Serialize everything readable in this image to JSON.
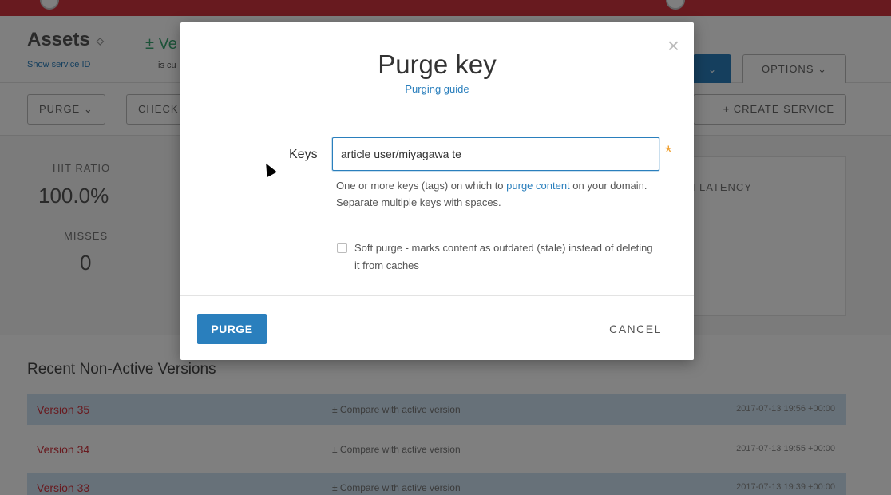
{
  "background": {
    "title": "Assets",
    "title_chevron": "◇",
    "show_service_id": "Show service ID",
    "version_fragment": "± Ve",
    "status_fragment": "is cu",
    "activate_chevron": "⌄",
    "options_label": "OPTIONS ⌄",
    "toolbar": {
      "purge_label": "PURGE ⌄",
      "check_label": "CHECK",
      "create_service_label": "+ CREATE SERVICE"
    },
    "stats": {
      "hit_ratio_label": "HIT RATIO",
      "hit_ratio_value": "100.0%",
      "misses_label": "MISSES",
      "misses_value": "0",
      "latency_label": "N LATENCY"
    },
    "recent_title": "Recent Non-Active Versions",
    "versions": [
      {
        "name": "Version 35",
        "compare": "± Compare with active version",
        "date": "2017-07-13 19:56 +00:00"
      },
      {
        "name": "Version 34",
        "compare": "± Compare with active version",
        "date": "2017-07-13 19:55 +00:00"
      },
      {
        "name": "Version 33",
        "compare": "± Compare with active version",
        "date": "2017-07-13 19:39 +00:00"
      }
    ]
  },
  "modal": {
    "title": "Purge key",
    "guide_link": "Purging guide",
    "close_glyph": "×",
    "keys_label": "Keys",
    "keys_value": "article user/miyagawa te",
    "required_mark": "*",
    "help_prefix": "One or more keys (tags) on which to ",
    "help_link": "purge content",
    "help_suffix": " on your domain. Separate multiple keys with spaces.",
    "soft_purge_label": "Soft purge - marks content as outdated (stale) instead of deleting it from caches",
    "purge_button": "PURGE",
    "cancel_button": "CANCEL"
  },
  "colors": {
    "accent": "#2a7fbd",
    "danger": "#d0353f",
    "required": "#f0a030"
  }
}
